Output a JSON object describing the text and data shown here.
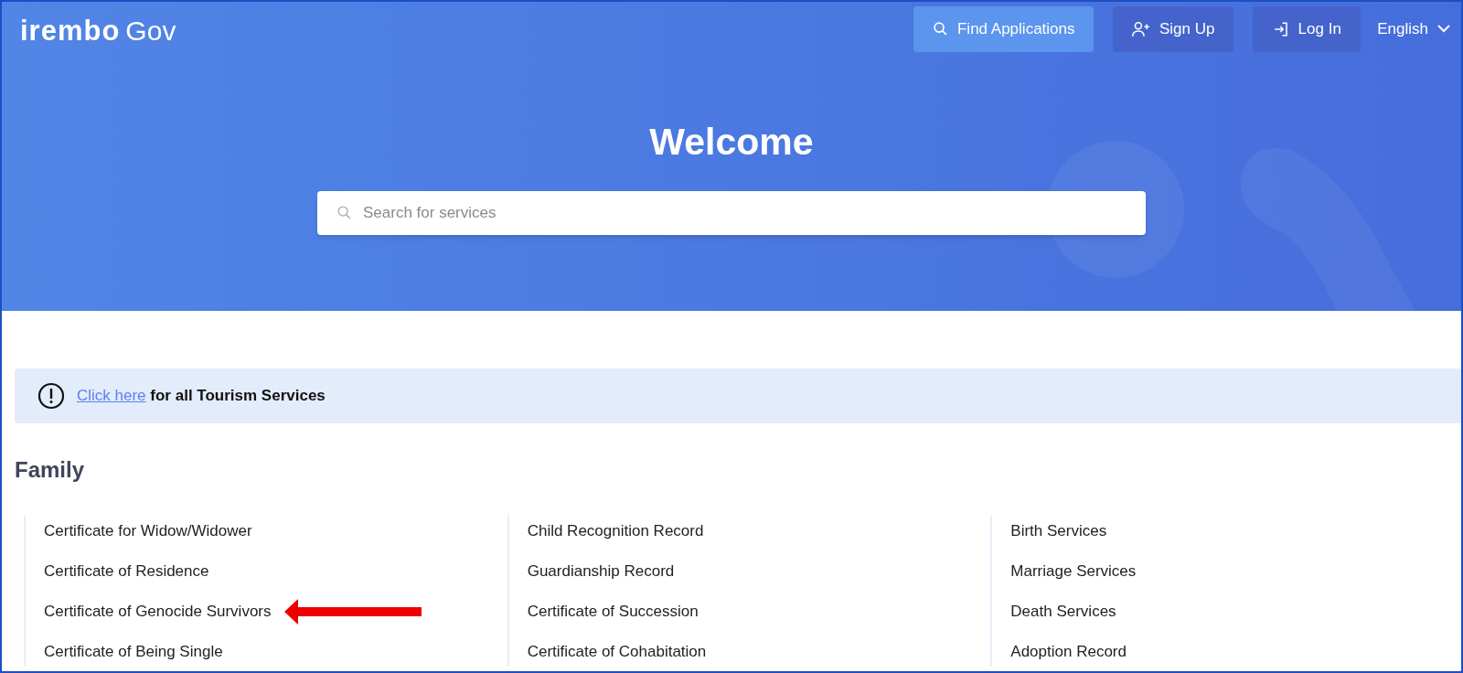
{
  "header": {
    "logo": {
      "brand": "irembo",
      "suffix": "Gov"
    },
    "buttons": [
      {
        "kind": "search",
        "label": "Find Applications",
        "selected": true
      },
      {
        "kind": "signup",
        "label": "Sign Up",
        "selected": false
      },
      {
        "kind": "login",
        "label": "Log In",
        "selected": false
      }
    ],
    "language": {
      "label": "English",
      "expanded": false
    }
  },
  "hero": {
    "title": "Welcome",
    "search": {
      "placeholder": "Search for services"
    }
  },
  "notice": {
    "link": "Click here",
    "text": "for all Tourism Services"
  },
  "section": {
    "title": "Family",
    "columns": [
      [
        {
          "label": "Certificate for Widow/Widower",
          "marked": false
        },
        {
          "label": "Certificate of Residence",
          "marked": false
        },
        {
          "label": "Certificate of Genocide Survivors",
          "marked": true
        },
        {
          "label": "Certificate of Being Single",
          "marked": false
        }
      ],
      [
        {
          "label": "Child Recognition Record",
          "marked": false
        },
        {
          "label": "Guardianship Record",
          "marked": false
        },
        {
          "label": "Certificate of Succession",
          "marked": false
        },
        {
          "label": "Certificate of Cohabitation",
          "marked": false
        }
      ],
      [
        {
          "label": "Birth Services",
          "marked": false
        },
        {
          "label": "Marriage Services",
          "marked": false
        },
        {
          "label": "Death Services",
          "marked": false
        },
        {
          "label": "Adoption Record",
          "marked": false
        }
      ]
    ]
  }
}
